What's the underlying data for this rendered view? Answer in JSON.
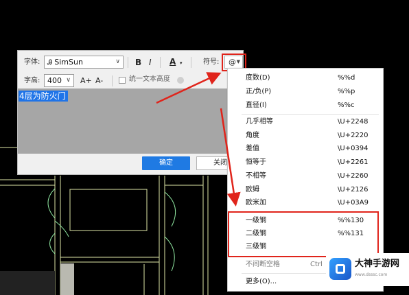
{
  "toolbar": {
    "font_label": "字体:",
    "font_value": "SimSun",
    "bold": "B",
    "italic": "I",
    "color_letter": "A",
    "symbol_label": "符号:",
    "symbol_value": "@",
    "size_label": "字高:",
    "size_value": "400",
    "size_up": "A+",
    "size_down": "A-",
    "unify_label": "统一文本高度"
  },
  "editor": {
    "text": "4层为防火门"
  },
  "buttons": {
    "ok": "确定",
    "cancel": "关闭"
  },
  "symbol_menu": {
    "items": [
      {
        "label": "度数(D)",
        "code": "%%d"
      },
      {
        "label": "正/负(P)",
        "code": "%%p"
      },
      {
        "label": "直径(I)",
        "code": "%%c"
      },
      {
        "label": "几乎相等",
        "code": "\\U+2248"
      },
      {
        "label": "角度",
        "code": "\\U+2220"
      },
      {
        "label": "差值",
        "code": "\\U+0394"
      },
      {
        "label": "恒等于",
        "code": "\\U+2261"
      },
      {
        "label": "不相等",
        "code": "\\U+2260"
      },
      {
        "label": "欧姆",
        "code": "\\U+2126"
      },
      {
        "label": "欧米加",
        "code": "\\U+03A9"
      },
      {
        "label": "一级钢",
        "code": "%%130"
      },
      {
        "label": "二级钢",
        "code": "%%131"
      },
      {
        "label": "三级钢",
        "code": ""
      },
      {
        "label": "不间断空格",
        "code": "Ctrl"
      },
      {
        "label": "更多(O)...",
        "code": ""
      }
    ]
  },
  "watermark": {
    "name": "大神手游网",
    "url": "www.dsssc.com"
  },
  "colors": {
    "accent": "#1f7ae3",
    "highlight": "#e0241b",
    "cad_line": "#dfe9a8",
    "cad_line_green": "#8fe6a0"
  }
}
